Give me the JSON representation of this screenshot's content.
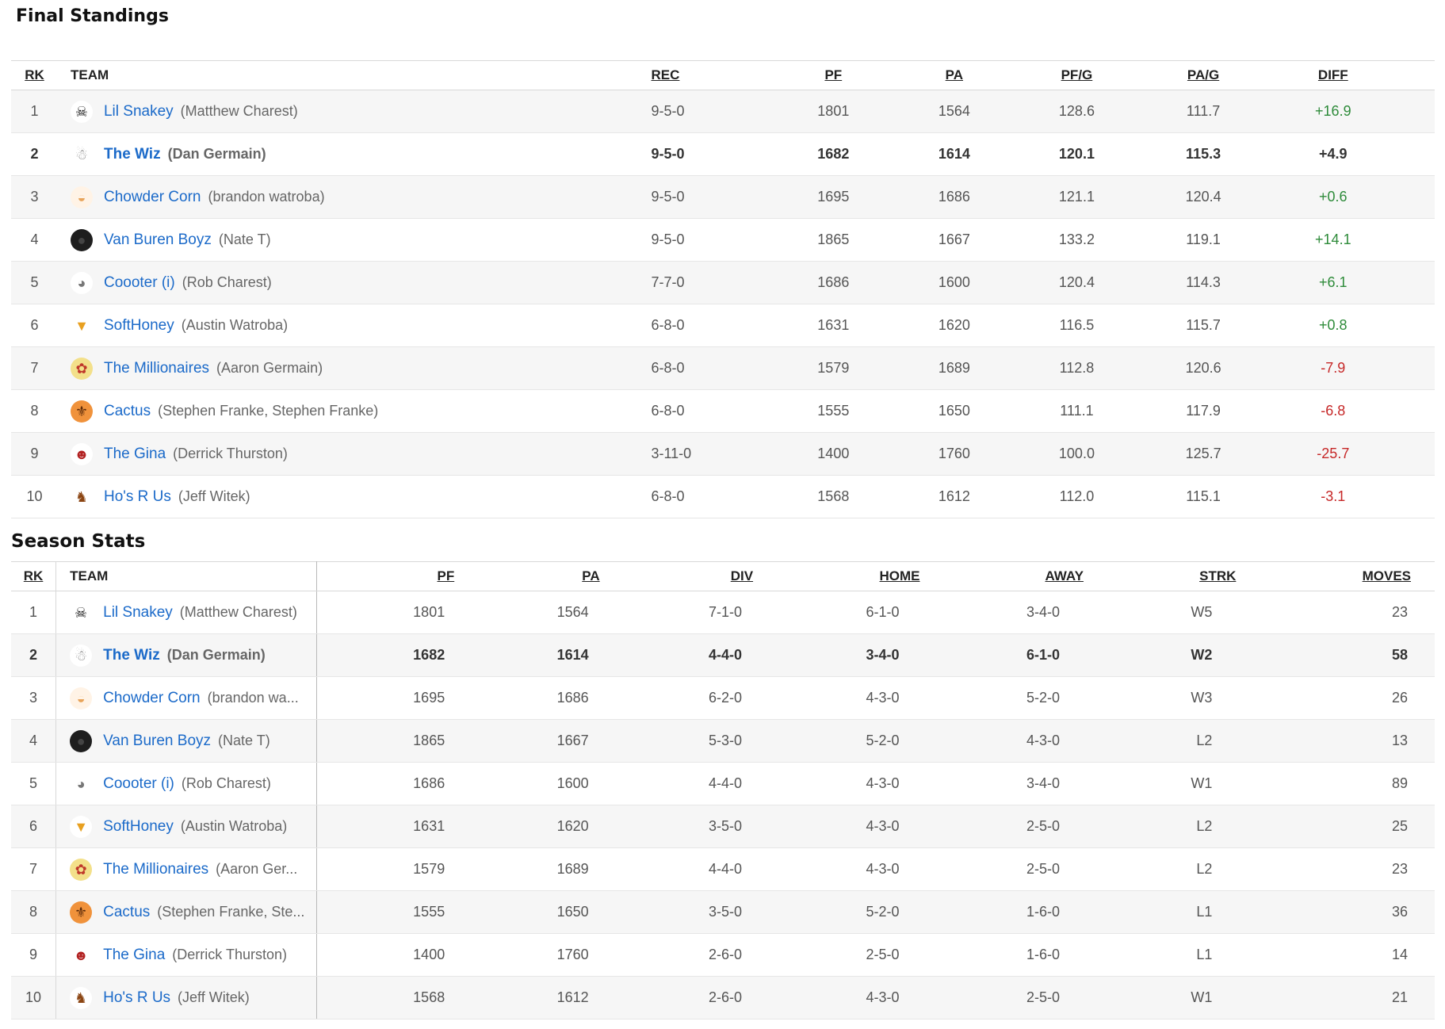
{
  "final_standings": {
    "title": "Final Standings",
    "headers": {
      "rk": "RK",
      "team": "TEAM",
      "rec": "REC",
      "pf": "PF",
      "pa": "PA",
      "pfg": "PF/G",
      "pag": "PA/G",
      "diff": "DIFF"
    },
    "rows": [
      {
        "rk": "1",
        "team": "Lil Snakey",
        "owner": "(Matthew Charest)",
        "rec": "9-5-0",
        "pf": "1801",
        "pa": "1564",
        "pfg": "128.6",
        "pag": "111.7",
        "diff": "+16.9"
      },
      {
        "rk": "2",
        "team": "The Wiz",
        "owner": "(Dan Germain)",
        "rec": "9-5-0",
        "pf": "1682",
        "pa": "1614",
        "pfg": "120.1",
        "pag": "115.3",
        "diff": "+4.9"
      },
      {
        "rk": "3",
        "team": "Chowder Corn",
        "owner": "(brandon watroba)",
        "rec": "9-5-0",
        "pf": "1695",
        "pa": "1686",
        "pfg": "121.1",
        "pag": "120.4",
        "diff": "+0.6"
      },
      {
        "rk": "4",
        "team": "Van Buren Boyz",
        "owner": "(Nate T)",
        "rec": "9-5-0",
        "pf": "1865",
        "pa": "1667",
        "pfg": "133.2",
        "pag": "119.1",
        "diff": "+14.1"
      },
      {
        "rk": "5",
        "team": "Coooter (i)",
        "owner": "(Rob Charest)",
        "rec": "7-7-0",
        "pf": "1686",
        "pa": "1600",
        "pfg": "120.4",
        "pag": "114.3",
        "diff": "+6.1"
      },
      {
        "rk": "6",
        "team": "SoftHoney",
        "owner": "(Austin Watroba)",
        "rec": "6-8-0",
        "pf": "1631",
        "pa": "1620",
        "pfg": "116.5",
        "pag": "115.7",
        "diff": "+0.8"
      },
      {
        "rk": "7",
        "team": "The Millionaires",
        "owner": "(Aaron Germain)",
        "rec": "6-8-0",
        "pf": "1579",
        "pa": "1689",
        "pfg": "112.8",
        "pag": "120.6",
        "diff": "-7.9"
      },
      {
        "rk": "8",
        "team": "Cactus",
        "owner": "(Stephen Franke, Stephen Franke)",
        "rec": "6-8-0",
        "pf": "1555",
        "pa": "1650",
        "pfg": "111.1",
        "pag": "117.9",
        "diff": "-6.8"
      },
      {
        "rk": "9",
        "team": "The Gina",
        "owner": "(Derrick Thurston)",
        "rec": "3-11-0",
        "pf": "1400",
        "pa": "1760",
        "pfg": "100.0",
        "pag": "125.7",
        "diff": "-25.7"
      },
      {
        "rk": "10",
        "team": "Ho's R Us",
        "owner": "(Jeff Witek)",
        "rec": "6-8-0",
        "pf": "1568",
        "pa": "1612",
        "pfg": "112.0",
        "pag": "115.1",
        "diff": "-3.1"
      }
    ]
  },
  "season_stats": {
    "title": "Season Stats",
    "headers": {
      "rk": "RK",
      "team": "TEAM",
      "pf": "PF",
      "pa": "PA",
      "div": "DIV",
      "home": "HOME",
      "away": "AWAY",
      "strk": "STRK",
      "moves": "MOVES"
    },
    "rows": [
      {
        "rk": "1",
        "team": "Lil Snakey",
        "owner": "(Matthew Charest)",
        "pf": "1801",
        "pa": "1564",
        "div": "7-1-0",
        "home": "6-1-0",
        "away": "3-4-0",
        "strk": "W5",
        "moves": "23"
      },
      {
        "rk": "2",
        "team": "The Wiz",
        "owner": "(Dan Germain)",
        "pf": "1682",
        "pa": "1614",
        "div": "4-4-0",
        "home": "3-4-0",
        "away": "6-1-0",
        "strk": "W2",
        "moves": "58"
      },
      {
        "rk": "3",
        "team": "Chowder Corn",
        "owner": "(brandon wa...",
        "pf": "1695",
        "pa": "1686",
        "div": "6-2-0",
        "home": "4-3-0",
        "away": "5-2-0",
        "strk": "W3",
        "moves": "26"
      },
      {
        "rk": "4",
        "team": "Van Buren Boyz",
        "owner": "(Nate T)",
        "pf": "1865",
        "pa": "1667",
        "div": "5-3-0",
        "home": "5-2-0",
        "away": "4-3-0",
        "strk": "L2",
        "moves": "13"
      },
      {
        "rk": "5",
        "team": "Coooter (i)",
        "owner": "(Rob Charest)",
        "pf": "1686",
        "pa": "1600",
        "div": "4-4-0",
        "home": "4-3-0",
        "away": "3-4-0",
        "strk": "W1",
        "moves": "89"
      },
      {
        "rk": "6",
        "team": "SoftHoney",
        "owner": "(Austin Watroba)",
        "pf": "1631",
        "pa": "1620",
        "div": "3-5-0",
        "home": "4-3-0",
        "away": "2-5-0",
        "strk": "L2",
        "moves": "25"
      },
      {
        "rk": "7",
        "team": "The Millionaires",
        "owner": "(Aaron Ger...",
        "pf": "1579",
        "pa": "1689",
        "div": "4-4-0",
        "home": "4-3-0",
        "away": "2-5-0",
        "strk": "L2",
        "moves": "23"
      },
      {
        "rk": "8",
        "team": "Cactus",
        "owner": "(Stephen Franke, Ste...",
        "pf": "1555",
        "pa": "1650",
        "div": "3-5-0",
        "home": "5-2-0",
        "away": "1-6-0",
        "strk": "L1",
        "moves": "36"
      },
      {
        "rk": "9",
        "team": "The Gina",
        "owner": "(Derrick Thurston)",
        "pf": "1400",
        "pa": "1760",
        "div": "2-6-0",
        "home": "2-5-0",
        "away": "1-6-0",
        "strk": "L1",
        "moves": "14"
      },
      {
        "rk": "10",
        "team": "Ho's R Us",
        "owner": "(Jeff Witek)",
        "pf": "1568",
        "pa": "1612",
        "div": "2-6-0",
        "home": "4-3-0",
        "away": "2-5-0",
        "strk": "W1",
        "moves": "21"
      }
    ]
  },
  "logos": [
    {
      "icon": "pirate-skull-icon",
      "glyph": "☠",
      "bg": "#ffffff",
      "fg": "#111111"
    },
    {
      "icon": "wizard-icon",
      "glyph": "☃",
      "bg": "#ffffff",
      "fg": "#8a8a8a"
    },
    {
      "icon": "soup-bowl-icon",
      "glyph": "◒",
      "bg": "#fff3e6",
      "fg": "#e8a45a"
    },
    {
      "icon": "dark-portrait-icon",
      "glyph": "●",
      "bg": "#1e1e1e",
      "fg": "#444444"
    },
    {
      "icon": "critter-icon",
      "glyph": "◕",
      "bg": "#ffffff",
      "fg": "#777777"
    },
    {
      "icon": "drink-cup-icon",
      "glyph": "▼",
      "bg": "#ffffff",
      "fg": "#e8a020"
    },
    {
      "icon": "cartoon-character-icon",
      "glyph": "✿",
      "bg": "#f3e08a",
      "fg": "#c0392b"
    },
    {
      "icon": "cactus-icon",
      "glyph": "⚜",
      "bg": "#f0923b",
      "fg": "#5a2a0a"
    },
    {
      "icon": "clown-skull-icon",
      "glyph": "☻",
      "bg": "#ffffff",
      "fg": "#b22222"
    },
    {
      "icon": "boar-icon",
      "glyph": "♞",
      "bg": "#ffffff",
      "fg": "#8b4513"
    }
  ],
  "colors": {
    "link": "#1b6ac9",
    "positive": "#2e8b3a",
    "negative": "#c62828"
  },
  "highlight_rank": "2"
}
